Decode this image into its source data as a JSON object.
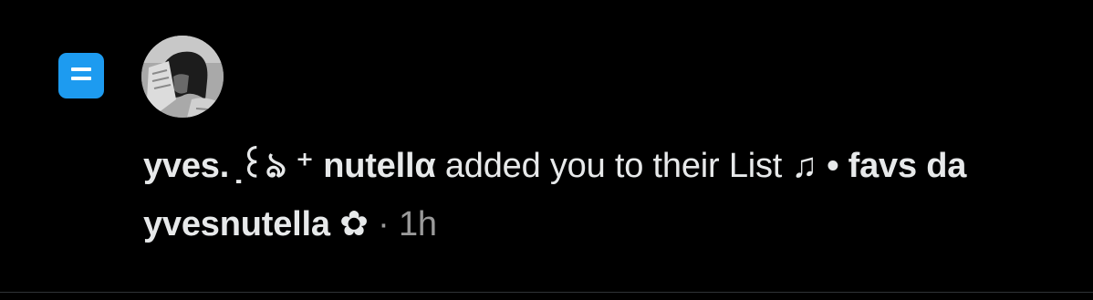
{
  "notification": {
    "icon": "list-icon",
    "accent_color": "#1d9bf0",
    "avatar_alt": "profile photo",
    "user_name": "yves. ̣꒰ঌ ⁺ nutellα",
    "action_text": "added you to their List",
    "list_name": "♫ • favs da yvesnutella ✿",
    "separator": "·",
    "timestamp": "1h"
  }
}
